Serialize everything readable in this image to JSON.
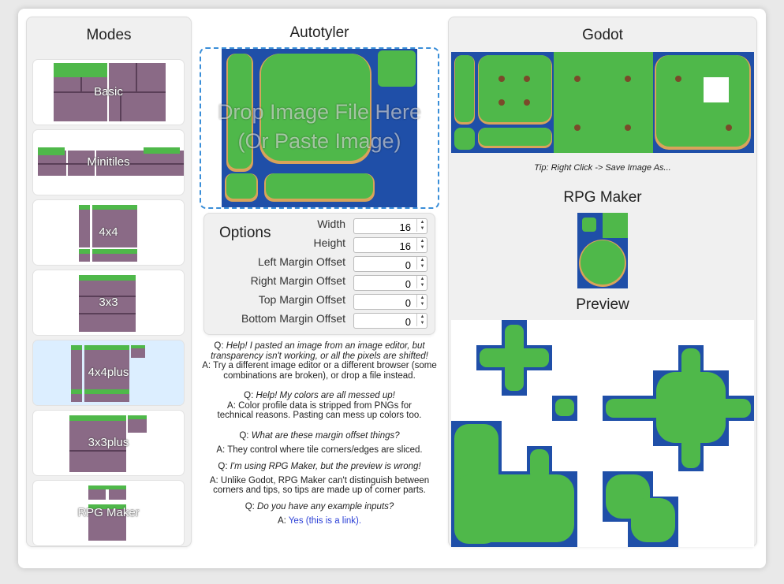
{
  "modes": {
    "title": "Modes",
    "items": [
      {
        "label": "Basic",
        "active": false
      },
      {
        "label": "Minitiles",
        "active": false
      },
      {
        "label": "4x4",
        "active": false
      },
      {
        "label": "3x3",
        "active": false
      },
      {
        "label": "4x4plus",
        "active": true
      },
      {
        "label": "3x3plus",
        "active": false
      },
      {
        "label": "RPG Maker",
        "active": false
      }
    ]
  },
  "autotyler": {
    "title": "Autotyler",
    "drop_line1": "Drop Image File Here",
    "drop_line2": "(Or Paste Image)"
  },
  "options": {
    "title": "Options",
    "fields": [
      {
        "label": "Width",
        "value": "16"
      },
      {
        "label": "Height",
        "value": "16"
      },
      {
        "label": "Left Margin Offset",
        "value": "0"
      },
      {
        "label": "Right Margin Offset",
        "value": "0"
      },
      {
        "label": "Top Margin Offset",
        "value": "0"
      },
      {
        "label": "Bottom Margin Offset",
        "value": "0"
      }
    ]
  },
  "faq": [
    {
      "q": "Help! I pasted an image from an image editor, but transparency isn't working, or all the pixels are shifted!",
      "a": "Try a different image editor or a different browser (some combinations are broken), or drop a file instead."
    },
    {
      "q": "Help! My colors are all messed up!",
      "a": "Color profile data is stripped from PNGs for technical reasons. Pasting can mess up colors too."
    },
    {
      "q": "What are these margin offset things?",
      "a": "They control where tile corners/edges are sliced."
    },
    {
      "q": "I'm using RPG Maker, but the preview is wrong!",
      "a": "Unlike Godot, RPG Maker can't distinguish between corners and tips, so tips are made up of corner parts."
    },
    {
      "q": "Do you have any example inputs?",
      "a": "",
      "link": "Yes (this is a link)."
    }
  ],
  "faq_prefix_q": "Q:",
  "faq_prefix_a": "A:",
  "godot": {
    "title": "Godot",
    "tip": "Tip: Right Click -> Save Image As...",
    "rpg_title": "RPG Maker",
    "preview_title": "Preview"
  },
  "colors": {
    "water": "#1f4fa8",
    "grass": "#4fb84a",
    "grass_dark": "#3a9a3a",
    "sand": "#d9a35a",
    "brick": "#8a6a86",
    "brick_dark": "#5a3f58",
    "accent": "#3a8ed8",
    "active_mode": "#dceeff"
  }
}
